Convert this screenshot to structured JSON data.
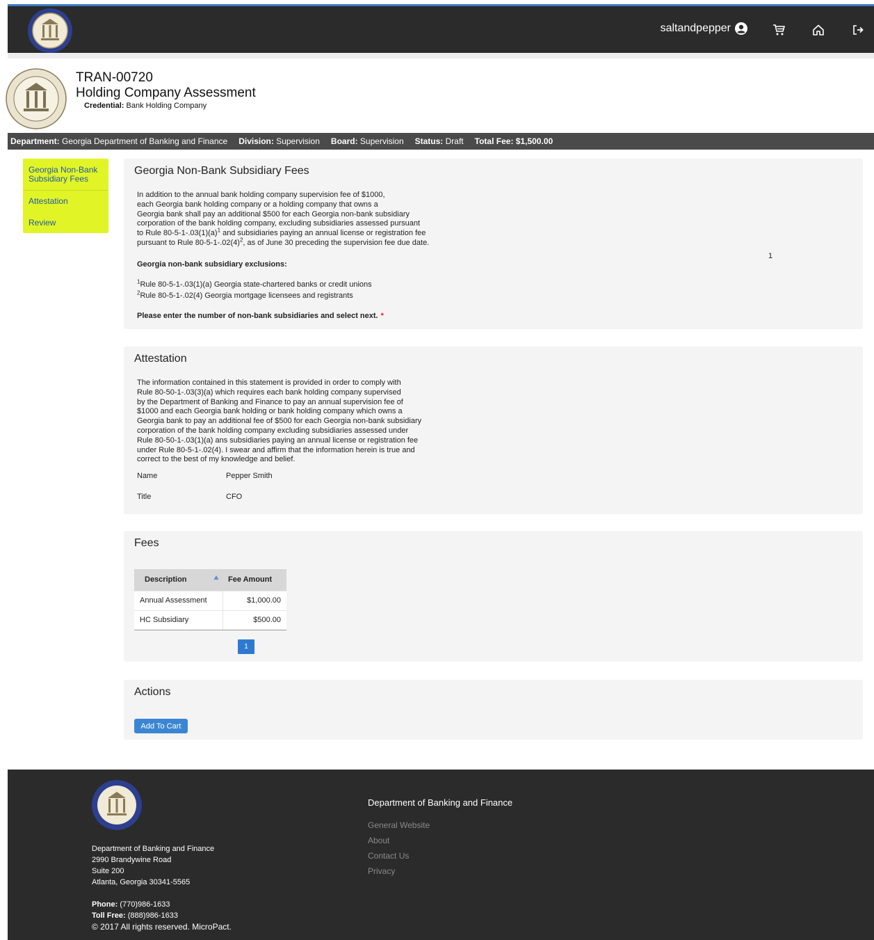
{
  "topnav": {
    "username": "saltandpepper",
    "icons": [
      "user-circle-icon",
      "cart-icon",
      "home-icon",
      "logout-icon"
    ]
  },
  "page_header": {
    "id": "TRAN-00720",
    "title": "Holding Company Assessment",
    "credential_label": "Credential:",
    "credential_value": "Bank Holding Company"
  },
  "infobar": {
    "department_label": "Department:",
    "department_value": "Georgia Department of Banking and Finance",
    "division_label": "Division:",
    "division_value": "Supervision",
    "board_label": "Board:",
    "board_value": "Supervision",
    "status_label": "Status:",
    "status_value": "Draft",
    "total_fee_label": "Total Fee:",
    "total_fee_value": "$1,500.00"
  },
  "sidenav": {
    "items": [
      {
        "label": "Georgia Non-Bank Subsidiary Fees"
      },
      {
        "label": "Attestation"
      },
      {
        "label": "Review"
      }
    ]
  },
  "subsidiary": {
    "heading": "Georgia Non-Bank Subsidiary Fees",
    "para_l1": "In addition to the annual bank holding company supervision fee of $1000,",
    "para_l2": "each Georgia bank holding company or a holding company that owns a",
    "para_l3": "Georgia bank shall pay an additional $500 for each Georgia non-bank subsidiary",
    "para_l4": "corporation of the bank holding company, excluding subsidiaries assessed pursuant",
    "para_l5a": "to Rule 80-5-1-.03(1)(a)",
    "para_l5b": " and subsidiaries paying an annual license or registration fee",
    "para_l6a": "pursuant to Rule 80-5-1-.02(4)",
    "para_l6b": ", as of June 30 preceding the supervision fee due date.",
    "sup1": "1",
    "sup2": "2",
    "exclusions_heading": "Georgia non-bank subsidiary exclusions:",
    "exclusion1": "Rule 80-5-1-.03(1)(a) Georgia state-chartered banks or credit unions",
    "exclusion2": "Rule 80-5-1-.02(4) Georgia mortgage licensees and registrants",
    "prompt": "Please enter the number of non-bank subsidiaries and select next.",
    "required_mark": "*",
    "count_value": "1"
  },
  "attestation": {
    "heading": "Attestation",
    "lines": [
      "The information contained in this statement is provided in order to comply with",
      "Rule 80-50-1-.03(3)(a) which requires each bank holding company supervised",
      "by the Department of Banking and Finance to pay an annual supervision fee of",
      "$1000 and each Georgia bank holding or bank holding company which owns a",
      "Georgia bank to pay an additional fee of $500 for each Georgia non-bank subsidiary",
      "corporation of the bank holding company excluding subsidiaries assessed under",
      "Rule 80-50-1-.03(1)(a) ans subsidiaries paying an annual license or registration fee",
      "under Rule 80-5-1-.02(4).  I swear and affirm that the information herein is true and",
      "correct to the best of my knowledge and belief."
    ],
    "name_label": "Name",
    "name_value": "Pepper Smith",
    "title_label": "Title",
    "title_value": "CFO"
  },
  "fees": {
    "heading": "Fees",
    "columns": [
      "Description",
      "Fee Amount"
    ],
    "rows": [
      {
        "description": "Annual Assessment",
        "amount": "$1,000.00"
      },
      {
        "description": "HC Subsidiary",
        "amount": "$500.00"
      }
    ],
    "page": "1"
  },
  "actions": {
    "heading": "Actions",
    "add_to_cart": "Add To Cart"
  },
  "footer": {
    "address_lines": [
      "Department of Banking and Finance",
      "2990 Brandywine Road",
      "Suite 200",
      "Atlanta, Georgia 30341-5565"
    ],
    "phone_label": "Phone:",
    "phone_value": "(770)986-1633",
    "tollfree_label": "Toll Free:",
    "tollfree_value": "(888)986-1633",
    "copyright": "© 2017 All rights reserved. MicroPact.",
    "links_heading": "Department of Banking and Finance",
    "links": [
      "General Website",
      "About",
      "Contact Us",
      "Privacy"
    ]
  },
  "colors": {
    "nav_bg": "#2b2b2b",
    "nav_accent": "#3a78c2",
    "sidenav_bg": "#e1f526",
    "link": "#1e5aa8",
    "button": "#3b86d3",
    "required": "#d9252a"
  }
}
